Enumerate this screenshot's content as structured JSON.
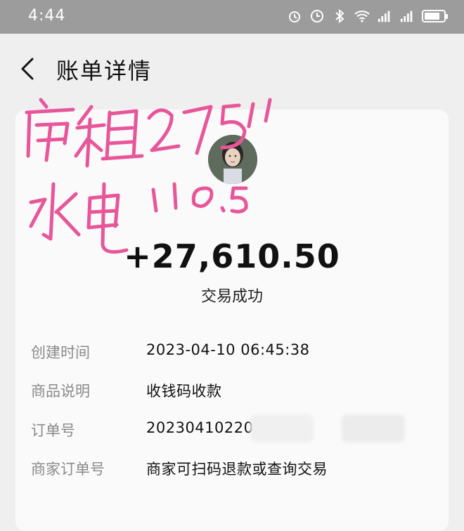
{
  "statusbar": {
    "time": "4:44",
    "network": "4G"
  },
  "navbar": {
    "title": "账单详情"
  },
  "transaction": {
    "amount": "+27,610.50",
    "status": "交易成功"
  },
  "details": [
    {
      "label": "创建时间",
      "value": "2023-04-10 06:45:38"
    },
    {
      "label": "商品说明",
      "value": "收钱码收款"
    },
    {
      "label": "订单号",
      "value": "20230410220"
    },
    {
      "label": "商家订单号",
      "value": "商家可扫码退款或查询交易"
    }
  ],
  "annotation": {
    "line1": "房租27500",
    "line2": "水电110.5",
    "color": "#e8569a"
  }
}
